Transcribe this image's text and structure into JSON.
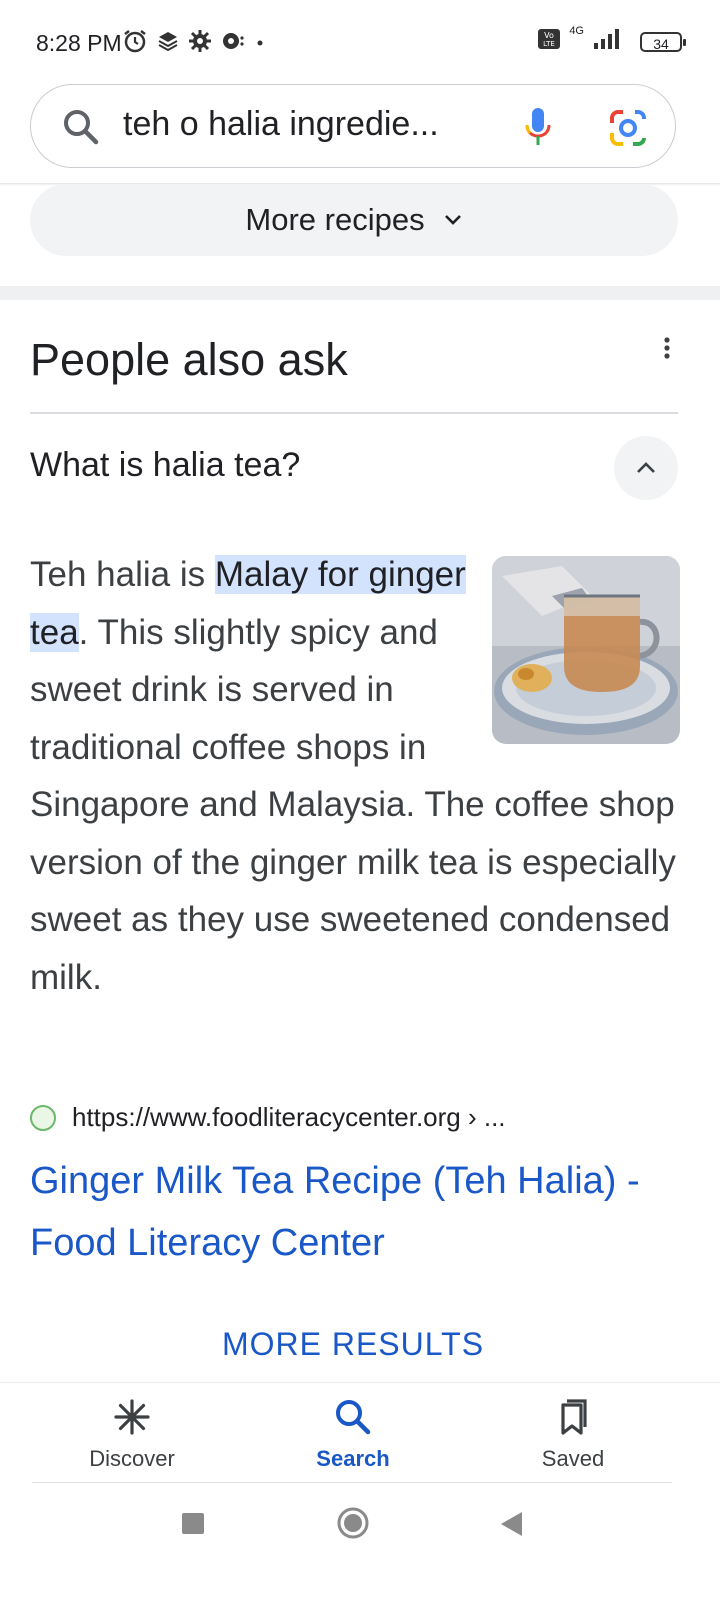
{
  "status_bar": {
    "time": "8:28 PM",
    "network": "4G",
    "volte": "Vo LTE",
    "battery": "34"
  },
  "search": {
    "query": "teh o halia ingredie..."
  },
  "more_recipes": {
    "label": "More recipes"
  },
  "people_also_ask": {
    "title": "People also ask",
    "question": "What is halia tea?",
    "answer": {
      "prefix": "Teh halia is ",
      "highlight": "Malay for ginger tea",
      "rest": ". This slightly spicy and sweet drink is served in traditional coffee shops in Singapore and Malaysia. The coffee shop version of the ginger milk tea is especially sweet as they use sweetened condensed milk."
    },
    "source_url": "https://www.foodliteracycenter.org › ...",
    "result_title": "Ginger Milk Tea Recipe (Teh Halia) - Food Literacy Center"
  },
  "more_results": {
    "label": "MORE RESULTS"
  },
  "bottom_nav": {
    "items": [
      {
        "label": "Discover",
        "icon": "asterisk-icon"
      },
      {
        "label": "Search",
        "icon": "search-icon",
        "active": true
      },
      {
        "label": "Saved",
        "icon": "bookmarks-icon"
      }
    ]
  },
  "colors": {
    "link_blue": "#1a57c7",
    "highlight": "#d3e3fd",
    "chip_bg": "#f1f3f4"
  }
}
